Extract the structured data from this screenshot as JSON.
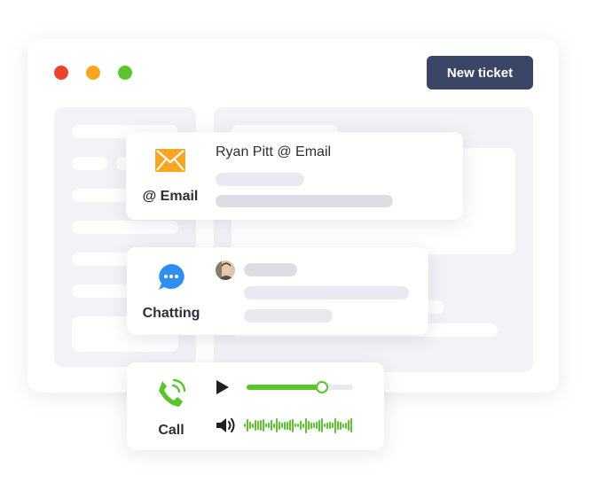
{
  "window": {
    "traffic_lights": [
      "#e8452c",
      "#f5a623",
      "#5cc42d"
    ],
    "new_ticket_label": "New ticket"
  },
  "email_card": {
    "icon": "envelope-icon",
    "label": "@ Email",
    "title": "Ryan Pitt @ Email",
    "accent": "#f5a623"
  },
  "chat_card": {
    "icon": "chat-bubble-icon",
    "label": "Chatting",
    "avatar": "avatar",
    "accent": "#2f8ff0"
  },
  "call_card": {
    "icon": "phone-ringing-icon",
    "label": "Call",
    "play_icon": "play-icon",
    "volume_icon": "volume-icon",
    "progress": 0.71,
    "accent": "#5cc42d"
  }
}
